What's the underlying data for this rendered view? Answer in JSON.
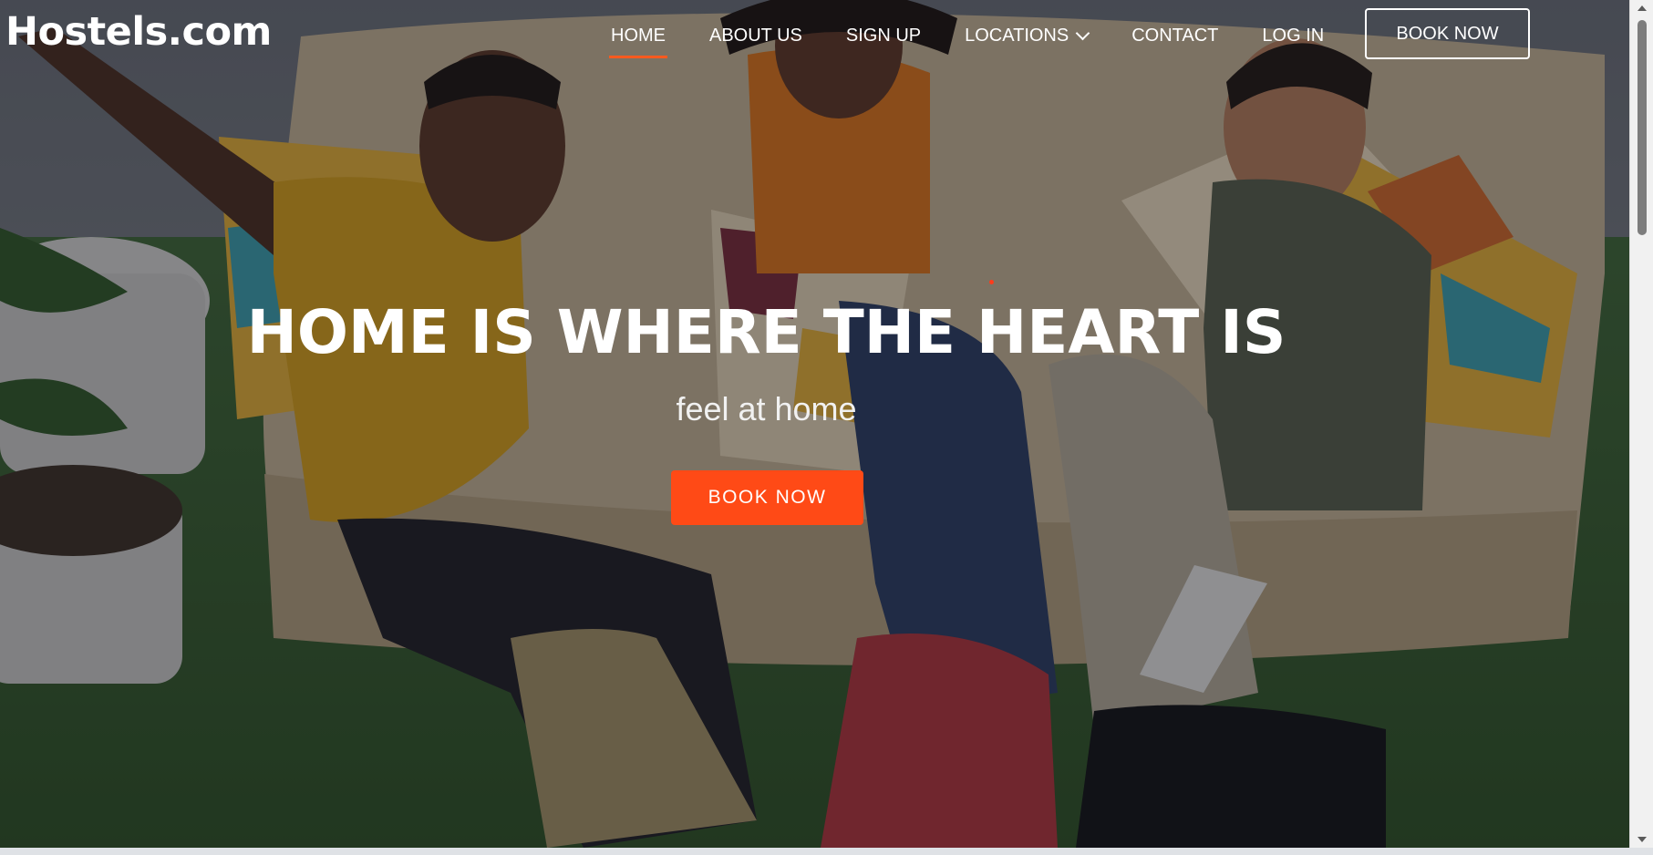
{
  "brand": "Hostels.com",
  "nav": {
    "items": [
      {
        "label": "HOME",
        "active": true
      },
      {
        "label": "ABOUT US",
        "active": false
      },
      {
        "label": "SIGN UP",
        "active": false
      },
      {
        "label": "LOCATIONS",
        "active": false,
        "dropdown": true
      },
      {
        "label": "CONTACT",
        "active": false
      },
      {
        "label": "LOG IN",
        "active": false
      }
    ],
    "cta": "BOOK NOW"
  },
  "hero": {
    "title": "HOME IS WHERE THE HEART IS",
    "subtitle": "feel at home",
    "button": "BOOK NOW",
    "background_image": "group of smiling friends lounging on a large beanbag with colorful cushions and backpacks",
    "overlay": "dark"
  },
  "colors": {
    "accent": "#ff4a16",
    "text": "#ffffff"
  },
  "icons": {
    "dropdown": "chevron-down-icon"
  }
}
